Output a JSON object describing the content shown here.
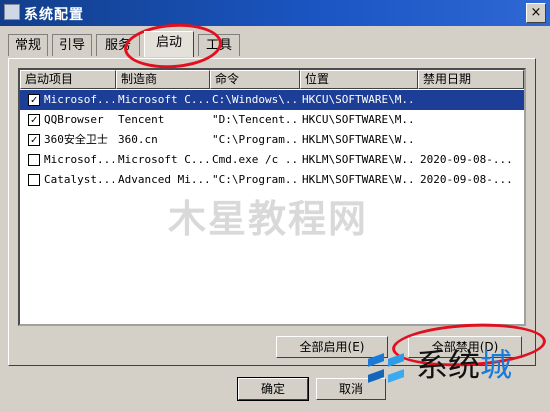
{
  "window": {
    "title": "系统配置",
    "close_glyph": "×"
  },
  "tabs": [
    {
      "label": "常规",
      "active": false
    },
    {
      "label": "引导",
      "active": false
    },
    {
      "label": "服务",
      "active": false
    },
    {
      "label": "启动",
      "active": true
    },
    {
      "label": "工具",
      "active": false
    }
  ],
  "table": {
    "columns": [
      "启动项目",
      "制造商",
      "命令",
      "位置",
      "禁用日期"
    ],
    "rows": [
      {
        "checked": true,
        "selected": true,
        "item": "Microsof...",
        "maker": "Microsoft C...",
        "command": "C:\\Windows\\...",
        "location": "HKCU\\SOFTWARE\\M...",
        "date": ""
      },
      {
        "checked": true,
        "selected": false,
        "item": "QQBrowser",
        "maker": "Tencent",
        "command": "\"D:\\Tencent...",
        "location": "HKCU\\SOFTWARE\\M...",
        "date": ""
      },
      {
        "checked": true,
        "selected": false,
        "item": "360安全卫士",
        "maker": "360.cn",
        "command": "\"C:\\Program...",
        "location": "HKLM\\SOFTWARE\\W...",
        "date": ""
      },
      {
        "checked": false,
        "selected": false,
        "item": "Microsof...",
        "maker": "Microsoft C...",
        "command": "Cmd.exe /c ...",
        "location": "HKLM\\SOFTWARE\\W...",
        "date": "2020-09-08-..."
      },
      {
        "checked": false,
        "selected": false,
        "item": "Catalyst...",
        "maker": "Advanced Mi...",
        "command": "\"C:\\Program...",
        "location": "HKLM\\SOFTWARE\\W...",
        "date": "2020-09-08-..."
      }
    ],
    "check_glyph": "✓"
  },
  "buttons": {
    "enable_all": "全部启用(E)",
    "disable_all": "全部禁用(D)",
    "ok": "确定",
    "cancel": "取消"
  },
  "watermark": "木星教程网",
  "logo": {
    "text_main": "系统",
    "text_accent": "城"
  },
  "colors": {
    "title_bar": "#1b56c4",
    "selection": "#1c3e96",
    "annotation": "#e01020",
    "logo_accent": "#1a7ad6"
  }
}
